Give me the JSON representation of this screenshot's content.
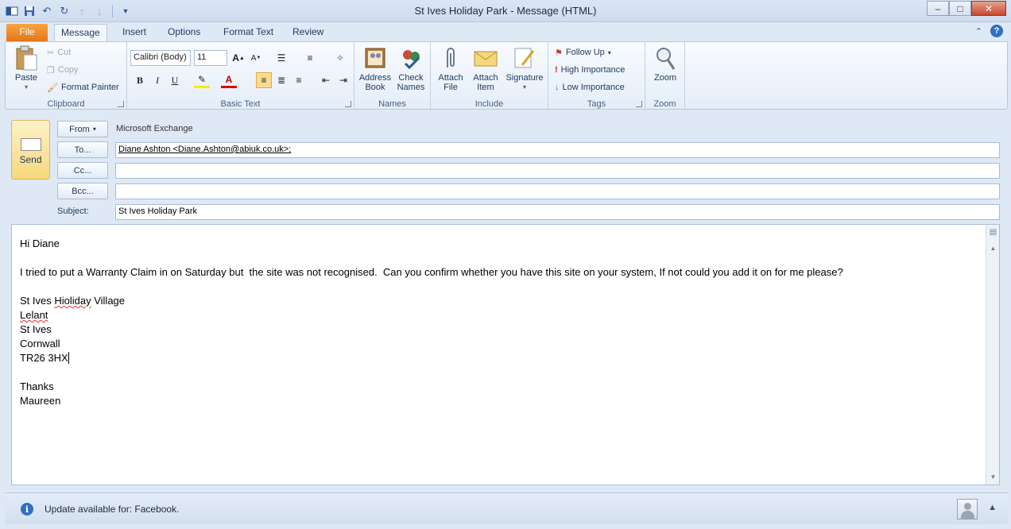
{
  "window": {
    "title": "St Ives Holiday Park  -  Message (HTML)",
    "controls": [
      "minimize",
      "maximize",
      "close"
    ]
  },
  "qat": {
    "icons": [
      "outlook-icon",
      "save-icon",
      "undo-icon",
      "redo-icon",
      "previous-icon",
      "next-icon",
      "customize-icon"
    ]
  },
  "tabs": [
    {
      "label": "File"
    },
    {
      "label": "Message"
    },
    {
      "label": "Insert"
    },
    {
      "label": "Options"
    },
    {
      "label": "Format Text"
    },
    {
      "label": "Review"
    }
  ],
  "ribbon": {
    "clipboard": {
      "label": "Clipboard",
      "paste": "Paste",
      "cut": "Cut",
      "copy": "Copy",
      "format_painter": "Format Painter"
    },
    "basic_text": {
      "label": "Basic Text",
      "font": "Calibri (Body)",
      "size": "11"
    },
    "names": {
      "label": "Names",
      "address_book_1": "Address",
      "address_book_2": "Book",
      "check_names_1": "Check",
      "check_names_2": "Names"
    },
    "include": {
      "label": "Include",
      "attach_file_1": "Attach",
      "attach_file_2": "File",
      "attach_item_1": "Attach",
      "attach_item_2": "Item",
      "signature": "Signature"
    },
    "tags": {
      "label": "Tags",
      "follow_up": "Follow Up",
      "high": "High Importance",
      "low": "Low Importance"
    },
    "zoom": {
      "label": "Zoom",
      "zoom": "Zoom"
    }
  },
  "header": {
    "send": "Send",
    "from_label": "From",
    "from_value": "Microsoft Exchange",
    "to_label": "To...",
    "to_value": "Diane Ashton <Diane.Ashton@abiuk.co.uk>;",
    "cc_label": "Cc...",
    "cc_value": "",
    "bcc_label": "Bcc...",
    "bcc_value": "",
    "subject_label": "Subject:",
    "subject_value": "St Ives Holiday Park"
  },
  "body": {
    "greeting": "Hi Diane",
    "paragraph": "I tried to put a Warranty Claim in on Saturday but  the site was not recognised.  Can you confirm whether you have this site on your system, If not could you add it on for me please?",
    "address_1a": "St Ives ",
    "address_1b": "Hioliday",
    "address_1c": " Village",
    "address_2": "Lelant",
    "address_3": "St Ives",
    "address_4": "Cornwall",
    "address_5": "TR26 3HX",
    "closing": "Thanks",
    "signature": "Maureen"
  },
  "statusbar": {
    "text": "Update available for: Facebook."
  },
  "colors": {
    "file_tab": "#e4741b",
    "send_button": "#f6d87d",
    "info": "#2f6fc4"
  }
}
